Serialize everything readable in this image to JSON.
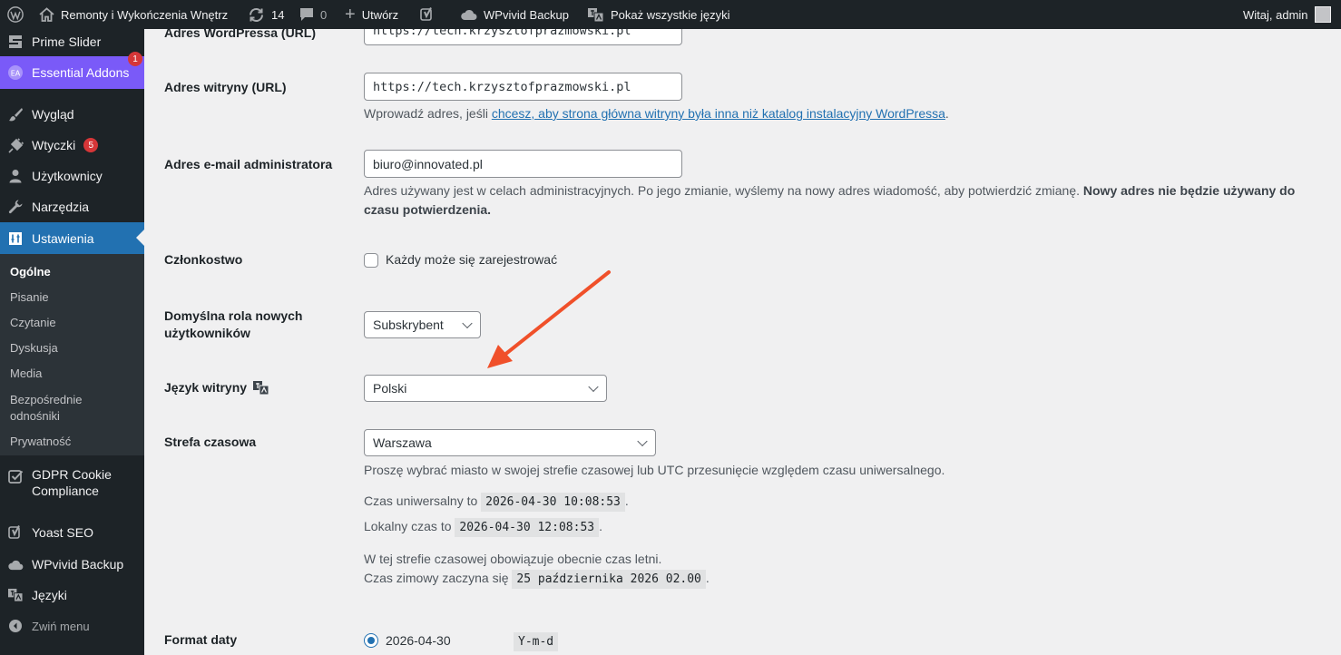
{
  "admin_bar": {
    "site_name": "Remonty i Wykończenia Wnętrz",
    "updates_count": "14",
    "comments_count": "0",
    "new_label": "Utwórz",
    "backup_label": "WPvivid Backup",
    "languages_label": "Pokaż wszystkie języki",
    "greeting": "Witaj, admin"
  },
  "sidebar": {
    "items": [
      {
        "label": "Prime Slider",
        "icon": "prime-slider-icon"
      },
      {
        "label": "Essential Addons",
        "icon": "essential-addons-icon",
        "badge": "1"
      },
      {
        "label": "Wygląd",
        "icon": "paintbrush-icon"
      },
      {
        "label": "Wtyczki",
        "icon": "plugin-icon",
        "badge": "5"
      },
      {
        "label": "Użytkownicy",
        "icon": "users-icon"
      },
      {
        "label": "Narzędzia",
        "icon": "wrench-icon"
      },
      {
        "label": "Ustawienia",
        "icon": "settings-icon"
      },
      {
        "label": "GDPR Cookie Compliance",
        "icon": "checkbox-icon"
      },
      {
        "label": "Yoast SEO",
        "icon": "yoast-icon"
      },
      {
        "label": "WPvivid Backup",
        "icon": "cloud-icon"
      },
      {
        "label": "Języki",
        "icon": "translate-icon"
      }
    ],
    "submenu": [
      "Ogólne",
      "Pisanie",
      "Czytanie",
      "Dyskusja",
      "Media",
      "Bezpośrednie odnośniki",
      "Prywatność"
    ],
    "collapse_label": "Zwiń menu"
  },
  "settings": {
    "wp_address_label": "Adres WordPressa (URL)",
    "wp_address_value": "https://tech.krzysztofprazmowski.pl",
    "site_address_label": "Adres witryny (URL)",
    "site_address_value": "https://tech.krzysztofprazmowski.pl",
    "site_address_desc_pre": "Wprowadź adres, jeśli ",
    "site_address_desc_link": "chcesz, aby strona główna witryny była inna niż katalog instalacyjny WordPressa",
    "site_address_desc_post": ".",
    "admin_email_label": "Adres e-mail administratora",
    "admin_email_value": "biuro@innovated.pl",
    "admin_email_desc": "Adres używany jest w celach administracyjnych. Po jego zmianie, wyślemy na nowy adres wiadomość, aby potwierdzić zmianę. ",
    "admin_email_desc_bold": "Nowy adres nie będzie używany do czasu potwierdzenia.",
    "membership_label": "Członkostwo",
    "membership_checkbox": "Każdy może się zarejestrować",
    "default_role_label": "Domyślna rola nowych użytkowników",
    "default_role_value": "Subskrybent",
    "site_language_label": "Język witryny",
    "site_language_value": "Polski",
    "timezone_label": "Strefa czasowa",
    "timezone_value": "Warszawa",
    "timezone_desc": "Proszę wybrać miasto w swojej strefie czasowej lub UTC przesunięcie względem czasu uniwersalnego.",
    "utc_time_label": "Czas uniwersalny to",
    "utc_time_value": "2026-04-30 10:08:53",
    "local_time_label": "Lokalny czas to",
    "local_time_value": "2026-04-30 12:08:53",
    "dst_line1": "W tej strefie czasowej obowiązuje obecnie czas letni.",
    "dst_line2_label": "Czas zimowy zaczyna się",
    "dst_line2_value": "25 października 2026 02.00",
    "date_format_label": "Format daty",
    "date_format_option": "2026-04-30",
    "date_format_code": "Y-m-d"
  },
  "colors": {
    "admin_dark": "#1d2327",
    "accent_blue": "#2271b1",
    "essential_addons": "#7a5af8",
    "annotation_arrow": "#f0502a",
    "badge_red": "#d63638"
  }
}
